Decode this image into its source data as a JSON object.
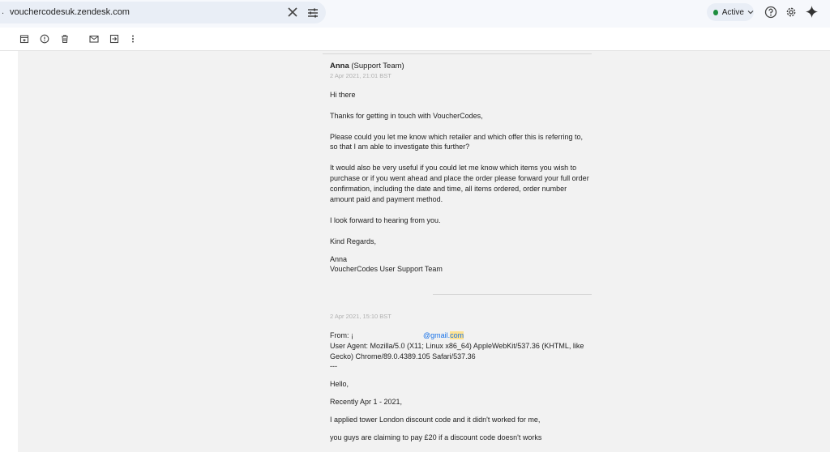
{
  "search": {
    "lead_glyph": ".",
    "query": "vouchercodesuk.zendesk.com"
  },
  "status": {
    "label": "Active",
    "color": "#1e8e3e"
  },
  "toolbar": {
    "icons": [
      "archive-icon",
      "report-spam-icon",
      "delete-icon",
      "mark-unread-icon",
      "move-to-icon",
      "more-options-icon"
    ]
  },
  "message1": {
    "author_name": "Anna",
    "author_team": "(Support Team)",
    "date": "2 Apr 2021, 21:01 BST",
    "greeting": "Hi there",
    "p1": "Thanks for getting in touch with VoucherCodes,",
    "p2_line1": "Please could you let me know which retailer and which offer this is referring to,",
    "p2_line2": "so that I am able to investigate this further?",
    "p3_line1": "It would also be very useful if you could let me know which items you wish to",
    "p3_line2": "purchase or if you went ahead and place the order please forward your full order",
    "p3_line3": "confirmation, including the date and time, all items ordered, order number",
    "p3_line4": "amount paid and payment method.",
    "p4": "I look forward to hearing from you.",
    "signoff": "Kind Regards,",
    "sig_name": "Anna",
    "sig_team": "VoucherCodes User Support Team"
  },
  "message2": {
    "date": "2 Apr 2021, 15:10 BST",
    "from_label": "From: ¡",
    "from_email_start": "@gmail.",
    "from_email_hl": "com",
    "ua_line1": "User Agent: Mozilla/5.0 (X11; Linux x86_64) AppleWebKit/537.36 (KHTML, like",
    "ua_line2": "Gecko) Chrome/89.0.4389.105 Safari/537.36",
    "divider": "---",
    "hello": "Hello,",
    "line_recent": "Recently Apr 1 - 2021,",
    "line_applied": "I applied tower London discount code and it didn't worked for me,",
    "line_claim": "you guys are claiming to pay £20 if a discount code doesn't works"
  }
}
